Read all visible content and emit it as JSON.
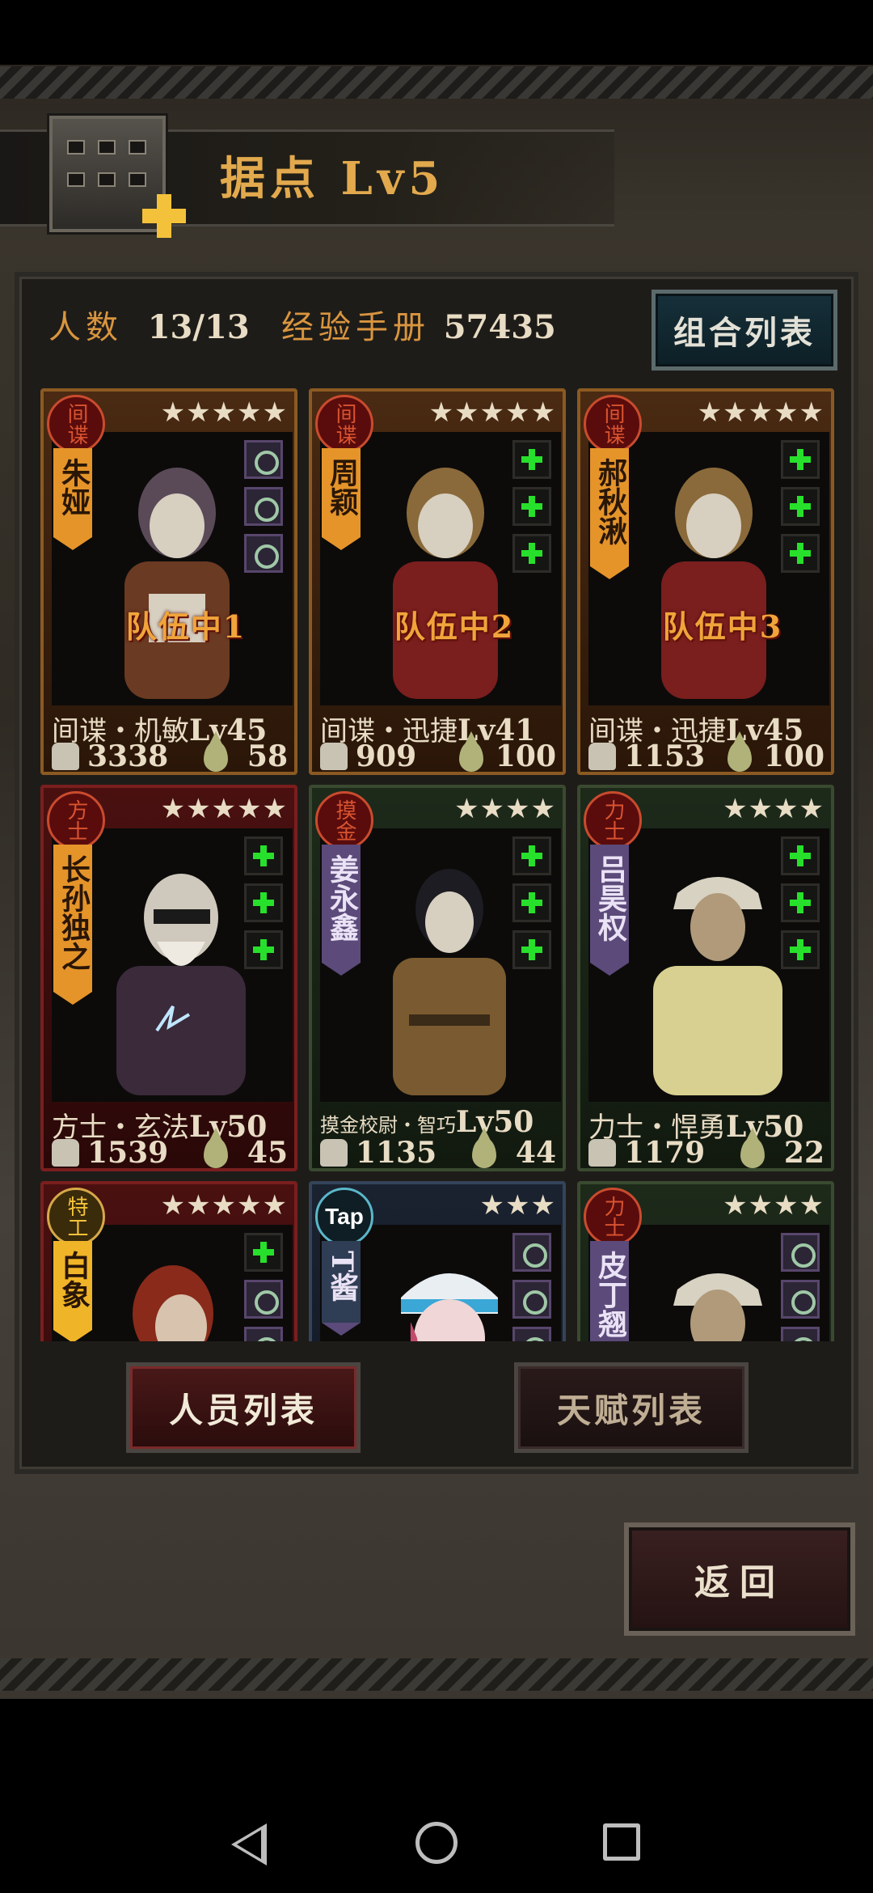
{
  "header": {
    "title": "据点 Lv5"
  },
  "stats": {
    "people_label": "人数",
    "people_value": "13/13",
    "exp_label": "经验手册",
    "exp_value": "57435"
  },
  "buttons": {
    "combo_list": "组合列表",
    "personnel_list": "人员列表",
    "talent_list": "天赋列表",
    "back": "返回"
  },
  "cards": [
    {
      "class": "间谍",
      "name": "朱娅",
      "stars": "★★★★★",
      "team": "队伍中1",
      "role": "间谍・机敏",
      "level": "Lv45",
      "power": "3338",
      "stamina": "58"
    },
    {
      "class": "间谍",
      "name": "周颖",
      "stars": "★★★★★",
      "team": "队伍中2",
      "role": "间谍・迅捷",
      "level": "Lv41",
      "power": "909",
      "stamina": "100"
    },
    {
      "class": "间谍",
      "name": "郝秋湫",
      "stars": "★★★★★",
      "team": "队伍中3",
      "role": "间谍・迅捷",
      "level": "Lv45",
      "power": "1153",
      "stamina": "100"
    },
    {
      "class": "方士",
      "name": "长孙独之",
      "stars": "★★★★★",
      "team": "",
      "role": "方士・玄法",
      "level": "Lv50",
      "power": "1539",
      "stamina": "45"
    },
    {
      "class": "摸金",
      "name": "姜永鑫",
      "stars": "★★★★",
      "team": "",
      "role": "摸金校尉・智巧",
      "level": "Lv50",
      "power": "1135",
      "stamina": "44"
    },
    {
      "class": "力士",
      "name": "吕昊权",
      "stars": "★★★★",
      "team": "",
      "role": "力士・悍勇",
      "level": "Lv50",
      "power": "1179",
      "stamina": "22"
    },
    {
      "class": "特工",
      "name": "白象",
      "stars": "★★★★★",
      "team": "",
      "role": "",
      "level": "",
      "power": "",
      "stamina": ""
    },
    {
      "class": "Tap",
      "name": "T酱",
      "stars": "★★★",
      "team": "",
      "role": "",
      "level": "",
      "power": "",
      "stamina": ""
    },
    {
      "class": "力士",
      "name": "皮丁翘",
      "stars": "★★★★",
      "team": "",
      "role": "",
      "level": "",
      "power": "",
      "stamina": ""
    }
  ]
}
